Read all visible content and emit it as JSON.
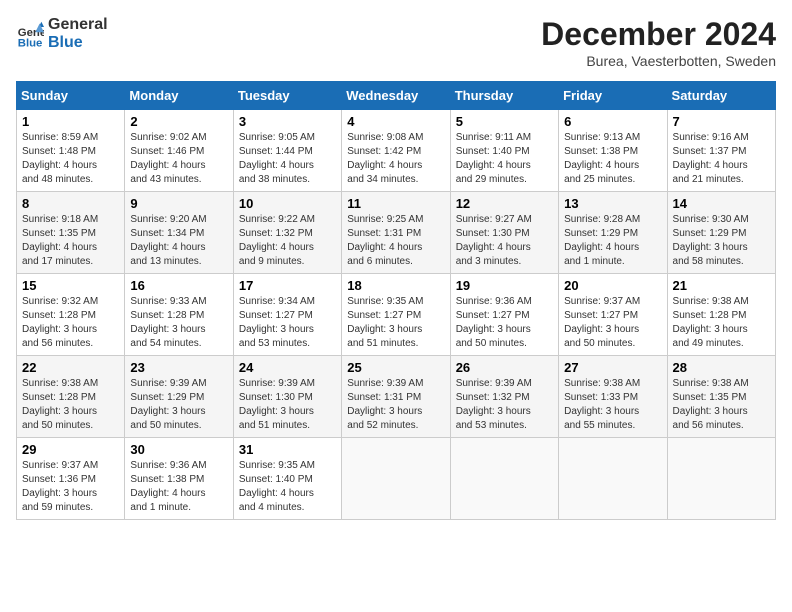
{
  "header": {
    "logo_line1": "General",
    "logo_line2": "Blue",
    "month": "December 2024",
    "location": "Burea, Vaesterbotten, Sweden"
  },
  "days_of_week": [
    "Sunday",
    "Monday",
    "Tuesday",
    "Wednesday",
    "Thursday",
    "Friday",
    "Saturday"
  ],
  "weeks": [
    [
      {
        "day": "1",
        "info": "Sunrise: 8:59 AM\nSunset: 1:48 PM\nDaylight: 4 hours\nand 48 minutes."
      },
      {
        "day": "2",
        "info": "Sunrise: 9:02 AM\nSunset: 1:46 PM\nDaylight: 4 hours\nand 43 minutes."
      },
      {
        "day": "3",
        "info": "Sunrise: 9:05 AM\nSunset: 1:44 PM\nDaylight: 4 hours\nand 38 minutes."
      },
      {
        "day": "4",
        "info": "Sunrise: 9:08 AM\nSunset: 1:42 PM\nDaylight: 4 hours\nand 34 minutes."
      },
      {
        "day": "5",
        "info": "Sunrise: 9:11 AM\nSunset: 1:40 PM\nDaylight: 4 hours\nand 29 minutes."
      },
      {
        "day": "6",
        "info": "Sunrise: 9:13 AM\nSunset: 1:38 PM\nDaylight: 4 hours\nand 25 minutes."
      },
      {
        "day": "7",
        "info": "Sunrise: 9:16 AM\nSunset: 1:37 PM\nDaylight: 4 hours\nand 21 minutes."
      }
    ],
    [
      {
        "day": "8",
        "info": "Sunrise: 9:18 AM\nSunset: 1:35 PM\nDaylight: 4 hours\nand 17 minutes."
      },
      {
        "day": "9",
        "info": "Sunrise: 9:20 AM\nSunset: 1:34 PM\nDaylight: 4 hours\nand 13 minutes."
      },
      {
        "day": "10",
        "info": "Sunrise: 9:22 AM\nSunset: 1:32 PM\nDaylight: 4 hours\nand 9 minutes."
      },
      {
        "day": "11",
        "info": "Sunrise: 9:25 AM\nSunset: 1:31 PM\nDaylight: 4 hours\nand 6 minutes."
      },
      {
        "day": "12",
        "info": "Sunrise: 9:27 AM\nSunset: 1:30 PM\nDaylight: 4 hours\nand 3 minutes."
      },
      {
        "day": "13",
        "info": "Sunrise: 9:28 AM\nSunset: 1:29 PM\nDaylight: 4 hours\nand 1 minute."
      },
      {
        "day": "14",
        "info": "Sunrise: 9:30 AM\nSunset: 1:29 PM\nDaylight: 3 hours\nand 58 minutes."
      }
    ],
    [
      {
        "day": "15",
        "info": "Sunrise: 9:32 AM\nSunset: 1:28 PM\nDaylight: 3 hours\nand 56 minutes."
      },
      {
        "day": "16",
        "info": "Sunrise: 9:33 AM\nSunset: 1:28 PM\nDaylight: 3 hours\nand 54 minutes."
      },
      {
        "day": "17",
        "info": "Sunrise: 9:34 AM\nSunset: 1:27 PM\nDaylight: 3 hours\nand 53 minutes."
      },
      {
        "day": "18",
        "info": "Sunrise: 9:35 AM\nSunset: 1:27 PM\nDaylight: 3 hours\nand 51 minutes."
      },
      {
        "day": "19",
        "info": "Sunrise: 9:36 AM\nSunset: 1:27 PM\nDaylight: 3 hours\nand 50 minutes."
      },
      {
        "day": "20",
        "info": "Sunrise: 9:37 AM\nSunset: 1:27 PM\nDaylight: 3 hours\nand 50 minutes."
      },
      {
        "day": "21",
        "info": "Sunrise: 9:38 AM\nSunset: 1:28 PM\nDaylight: 3 hours\nand 49 minutes."
      }
    ],
    [
      {
        "day": "22",
        "info": "Sunrise: 9:38 AM\nSunset: 1:28 PM\nDaylight: 3 hours\nand 50 minutes."
      },
      {
        "day": "23",
        "info": "Sunrise: 9:39 AM\nSunset: 1:29 PM\nDaylight: 3 hours\nand 50 minutes."
      },
      {
        "day": "24",
        "info": "Sunrise: 9:39 AM\nSunset: 1:30 PM\nDaylight: 3 hours\nand 51 minutes."
      },
      {
        "day": "25",
        "info": "Sunrise: 9:39 AM\nSunset: 1:31 PM\nDaylight: 3 hours\nand 52 minutes."
      },
      {
        "day": "26",
        "info": "Sunrise: 9:39 AM\nSunset: 1:32 PM\nDaylight: 3 hours\nand 53 minutes."
      },
      {
        "day": "27",
        "info": "Sunrise: 9:38 AM\nSunset: 1:33 PM\nDaylight: 3 hours\nand 55 minutes."
      },
      {
        "day": "28",
        "info": "Sunrise: 9:38 AM\nSunset: 1:35 PM\nDaylight: 3 hours\nand 56 minutes."
      }
    ],
    [
      {
        "day": "29",
        "info": "Sunrise: 9:37 AM\nSunset: 1:36 PM\nDaylight: 3 hours\nand 59 minutes."
      },
      {
        "day": "30",
        "info": "Sunrise: 9:36 AM\nSunset: 1:38 PM\nDaylight: 4 hours\nand 1 minute."
      },
      {
        "day": "31",
        "info": "Sunrise: 9:35 AM\nSunset: 1:40 PM\nDaylight: 4 hours\nand 4 minutes."
      },
      {
        "day": "",
        "info": ""
      },
      {
        "day": "",
        "info": ""
      },
      {
        "day": "",
        "info": ""
      },
      {
        "day": "",
        "info": ""
      }
    ]
  ]
}
